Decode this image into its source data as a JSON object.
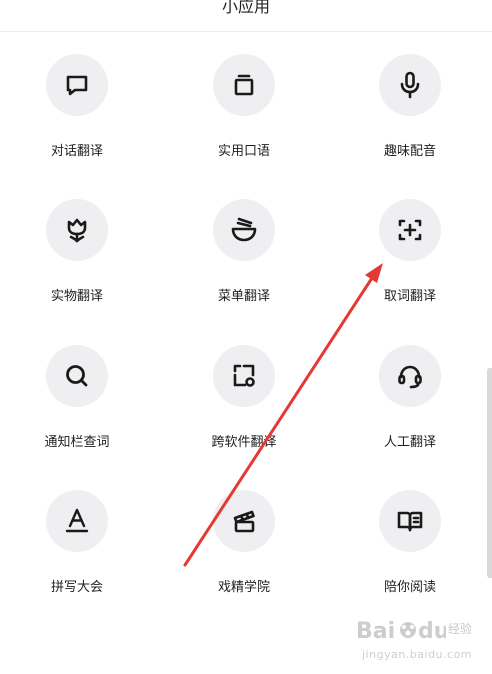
{
  "header": {
    "title": "小应用"
  },
  "apps": [
    {
      "label": "对话翻译",
      "icon": "chat-bubble-icon"
    },
    {
      "label": "实用口语",
      "icon": "card-stack-icon"
    },
    {
      "label": "趣味配音",
      "icon": "microphone-icon"
    },
    {
      "label": "实物翻译",
      "icon": "tulip-icon"
    },
    {
      "label": "菜单翻译",
      "icon": "noodle-bowl-icon"
    },
    {
      "label": "取词翻译",
      "icon": "scan-plus-icon"
    },
    {
      "label": "通知栏查词",
      "icon": "search-icon"
    },
    {
      "label": "跨软件翻译",
      "icon": "switch-apps-icon"
    },
    {
      "label": "人工翻译",
      "icon": "headset-icon"
    },
    {
      "label": "拼写大会",
      "icon": "letter-a-icon"
    },
    {
      "label": "戏精学院",
      "icon": "clapperboard-icon"
    },
    {
      "label": "陪你阅读",
      "icon": "open-book-icon"
    }
  ],
  "annotation": {
    "arrow_color": "#e53935"
  },
  "watermark": {
    "brand": "经验",
    "url": "jingyan.baidu.com"
  }
}
